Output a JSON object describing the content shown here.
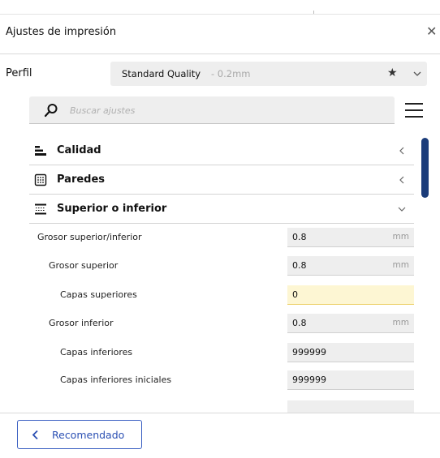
{
  "dialog": {
    "title": "Ajustes de impresión"
  },
  "profile": {
    "label": "Perfil",
    "name": "Standard Quality",
    "detail": " - 0.2mm"
  },
  "search": {
    "placeholder": "Buscar ajustes"
  },
  "sections": [
    {
      "label": "Calidad",
      "expanded": false,
      "icon": "quality-icon"
    },
    {
      "label": "Paredes",
      "expanded": false,
      "icon": "walls-icon"
    },
    {
      "label": "Superior o inferior",
      "expanded": true,
      "icon": "top-bottom-icon"
    }
  ],
  "settings": [
    {
      "label": "Grosor superior/inferior",
      "value": "0.8",
      "unit": "mm"
    },
    {
      "label": "Grosor superior",
      "value": "0.8",
      "unit": "mm"
    },
    {
      "label": "Capas superiores",
      "value": "0",
      "unit": ""
    },
    {
      "label": "Grosor inferior",
      "value": "0.8",
      "unit": "mm"
    },
    {
      "label": "Capas inferiores",
      "value": "999999",
      "unit": ""
    },
    {
      "label": "Capas inferiores iniciales",
      "value": "999999",
      "unit": ""
    }
  ],
  "footer": {
    "recommended_label": "Recomendado"
  },
  "colors": {
    "accent": "#2a4fb3",
    "scrollbar": "#1b3c7a",
    "warning_field": "#fdf6d3"
  }
}
